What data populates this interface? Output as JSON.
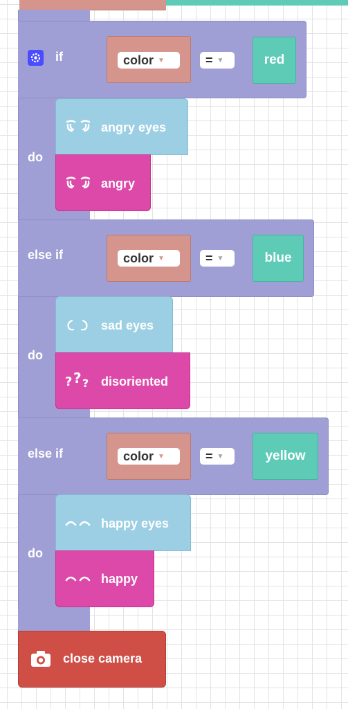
{
  "colors": {
    "if_block": "#a09fd5",
    "compare_block": "#d5958c",
    "color_literal": "#5ecbb7",
    "eyes_block": "#9ccfe3",
    "mood_block": "#dc49a8",
    "camera_block": "#cf4e45"
  },
  "if_block": {
    "gear_icon": "gear-icon",
    "if_label": "if",
    "branches": [
      {
        "condition_label": "if",
        "left_operand": "color",
        "operator": "=",
        "right_value": "red",
        "do_label": "do",
        "eyes_label": "angry eyes",
        "eyes_icon": "angry-eyes-icon",
        "mood_label": "angry",
        "mood_icon": "angry-face-icon"
      },
      {
        "condition_label": "else if",
        "left_operand": "color",
        "operator": "=",
        "right_value": "blue",
        "do_label": "do",
        "eyes_label": "sad eyes",
        "eyes_icon": "sad-eyes-icon",
        "mood_label": "disoriented",
        "mood_icon": "question-marks-icon"
      },
      {
        "condition_label": "else if",
        "left_operand": "color",
        "operator": "=",
        "right_value": "yellow",
        "do_label": "do",
        "eyes_label": "happy eyes",
        "eyes_icon": "happy-eyes-icon",
        "mood_label": "happy",
        "mood_icon": "happy-face-icon"
      }
    ]
  },
  "camera": {
    "label": "close camera",
    "icon": "camera-icon"
  }
}
